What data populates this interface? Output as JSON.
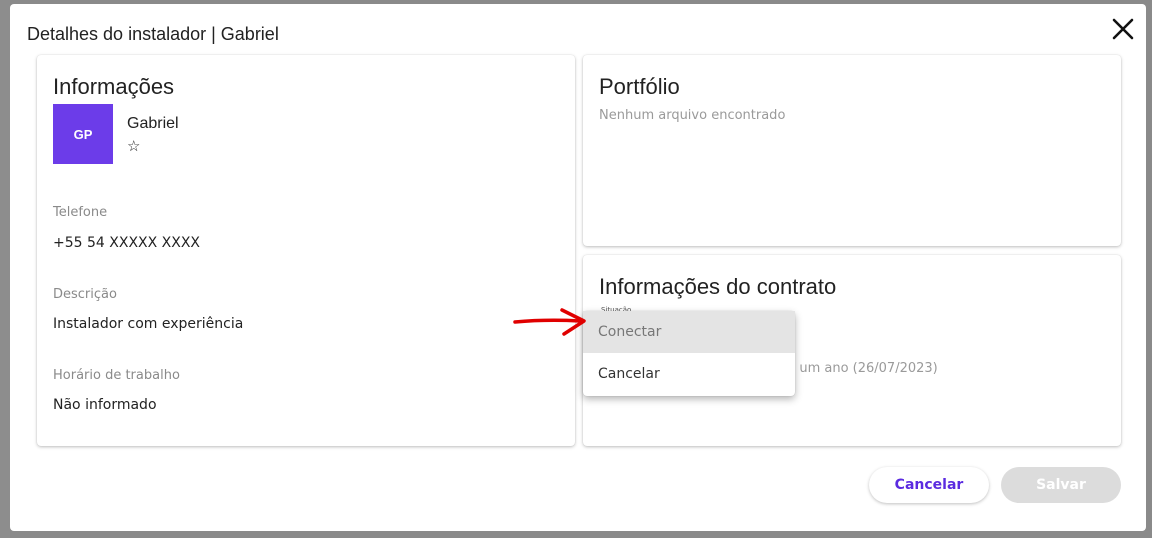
{
  "dialog": {
    "title": "Detalhes do instalador | Gabriel"
  },
  "info_card": {
    "title": "Informações",
    "avatar_initials": "GP",
    "name": "Gabriel",
    "rating_star": "☆",
    "phone_label": "Telefone",
    "phone_value": "+55 54  XXXXX XXXX",
    "description_label": "Descrição",
    "description_value": "Instalador com experiência",
    "hours_label": "Horário de trabalho",
    "hours_value": "Não informado"
  },
  "portfolio_card": {
    "title": "Portfólio",
    "empty_text": "Nenhum arquivo encontrado"
  },
  "contract_card": {
    "title": "Informações do contrato",
    "status_label": "Situação",
    "date_text": "há um ano (26/07/2023)"
  },
  "dropdown": {
    "options": [
      "Conectar",
      "Cancelar"
    ],
    "highlighted": "Conectar"
  },
  "footer": {
    "cancel_label": "Cancelar",
    "save_label": "Salvar"
  },
  "colors": {
    "accent": "#6c3ce9",
    "arrow": "#e00000"
  }
}
